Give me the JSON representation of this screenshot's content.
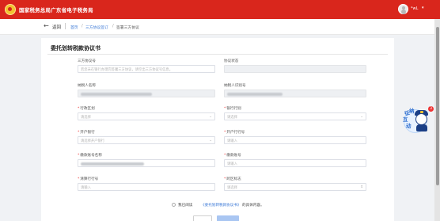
{
  "header": {
    "app_title": "国家税务总局广东省电子税务局",
    "user_name": "*wL",
    "user_chevron": "▾",
    "icons": {
      "emblem": "tax-emblem",
      "avatar": "user-avatar-icon"
    }
  },
  "subheader": {
    "back_arrow": "←",
    "back_label": "返回",
    "breadcrumb": {
      "home": "首页",
      "sep": "/",
      "mid": "三方协议签订",
      "current": "签署三方协议"
    }
  },
  "form": {
    "title": "委托划转税款协议书",
    "fields": {
      "agreement_no": {
        "label": "三方协议号",
        "placeholder": "若您未在银行办理完签署三方协议，请空出三方协议号信息。"
      },
      "agreement_status": {
        "label": "协议状态",
        "placeholder": ""
      },
      "taxpayer_name": {
        "label": "纳税人名称"
      },
      "taxpayer_id": {
        "label": "纳税人识别号"
      },
      "region": {
        "label": "行政区划",
        "required": "*",
        "placeholder": "请选择"
      },
      "bank_category": {
        "label": "银行行别",
        "required": "*",
        "placeholder": "请选择"
      },
      "open_bank": {
        "label": "开户银行",
        "required": "*",
        "placeholder": "请选择开户银行"
      },
      "open_bank_code": {
        "label": "开户行行号",
        "required": "*",
        "placeholder": "请输入"
      },
      "payer_account_name": {
        "label": "缴款账号名称",
        "required": "*"
      },
      "payer_account_no": {
        "label": "缴款账号",
        "required": "*",
        "placeholder": "请输入"
      },
      "clearing_bank_code": {
        "label": "清算行行号",
        "required": "*",
        "placeholder": "请输入"
      },
      "cross_region": {
        "label": "跨区标志",
        "required": "*",
        "placeholder": "请选择"
      }
    },
    "agreement": {
      "prefix": "我已阅读",
      "link": "《委托划转税款协议书》",
      "suffix": "的具体内容。"
    }
  },
  "floating_widget": {
    "chars": [
      "征",
      "纳",
      "互",
      "动"
    ],
    "notification_count": "3"
  },
  "colors": {
    "header_red": "#d9261c",
    "link_blue": "#3a78d6",
    "required_red": "#ee3333",
    "primary_disabled": "#a9c6f2"
  }
}
